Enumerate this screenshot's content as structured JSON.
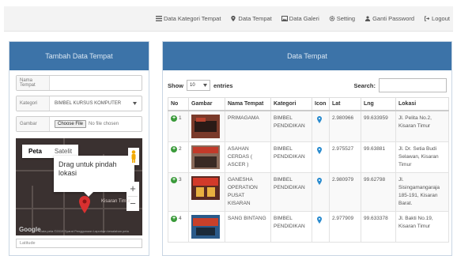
{
  "nav": {
    "items": [
      {
        "label": "Data Kategori Tempat",
        "icon": "list-icon"
      },
      {
        "label": "Data Tempat",
        "icon": "map-marker-icon"
      },
      {
        "label": "Data Galeri",
        "icon": "image-icon"
      },
      {
        "label": "Setting",
        "icon": "gear-icon"
      },
      {
        "label": "Ganti Password",
        "icon": "user-icon"
      },
      {
        "label": "Logout",
        "icon": "logout-icon"
      }
    ]
  },
  "form": {
    "title": "Tambah Data Tempat",
    "nama_label": "Nama Tempat",
    "nama_value": "",
    "kategori_label": "Kategori",
    "kategori_value": "BIMBEL KURSUS KOMPUTER",
    "gambar_label": "Gambar",
    "file_button": "Choose File",
    "file_status": "No file chosen",
    "latitude_label": "Latitude"
  },
  "map": {
    "type_map": "Peta",
    "type_satellite": "Satelit",
    "bubble_text": "Drag untuk pindah lokasi",
    "bubble_close": "×",
    "place_label": "Kisaran Timur",
    "zoom_in": "+",
    "zoom_out": "−",
    "logo": "Google",
    "copyright": "Data peta ©2019   Syarat Penggunaan   Laporkan kesalahan peta"
  },
  "table": {
    "title": "Data Tempat",
    "show_label": "Show",
    "entries_value": "10",
    "entries_label": "entries",
    "search_label": "Search:",
    "headers": [
      "No",
      "Gambar",
      "Nama Tempat",
      "Kategori",
      "Icon",
      "Lat",
      "Lng",
      "Lokasi"
    ],
    "rows": [
      {
        "no": "1",
        "nama": "PRIMAGAMA",
        "kategori": "BIMBEL PENDIDIKAN",
        "lat": "2.980966",
        "lng": "99.633959",
        "lokasi": "Jl. Pelita No.2, Kisaran Timur"
      },
      {
        "no": "2",
        "nama": "ASAHAN CERDAS ( ASCER )",
        "kategori": "BIMBEL PENDIDIKAN",
        "lat": "2.975527",
        "lng": "99.63881",
        "lokasi": "Jl. Dr. Setia Budi Selawan, Kisaran Timur"
      },
      {
        "no": "3",
        "nama": "GANESHA OPERATION PUSAT KISARAN",
        "kategori": "BIMBEL PENDIDIKAN",
        "lat": "2.980979",
        "lng": "99.62798",
        "lokasi": "Jl. Sisingamangaraja 185-191, Kisaran Barat."
      },
      {
        "no": "4",
        "nama": "SANG BINTANG",
        "kategori": "BIMBEL PENDIDIKAN",
        "lat": "2.977909",
        "lng": "99.633378",
        "lokasi": "Jl. Bakti No.19, Kisaran Timur"
      }
    ]
  },
  "colors": {
    "panel_header": "#3c73a8",
    "plus_button": "#3a9a3a",
    "pin": "#d93030"
  }
}
